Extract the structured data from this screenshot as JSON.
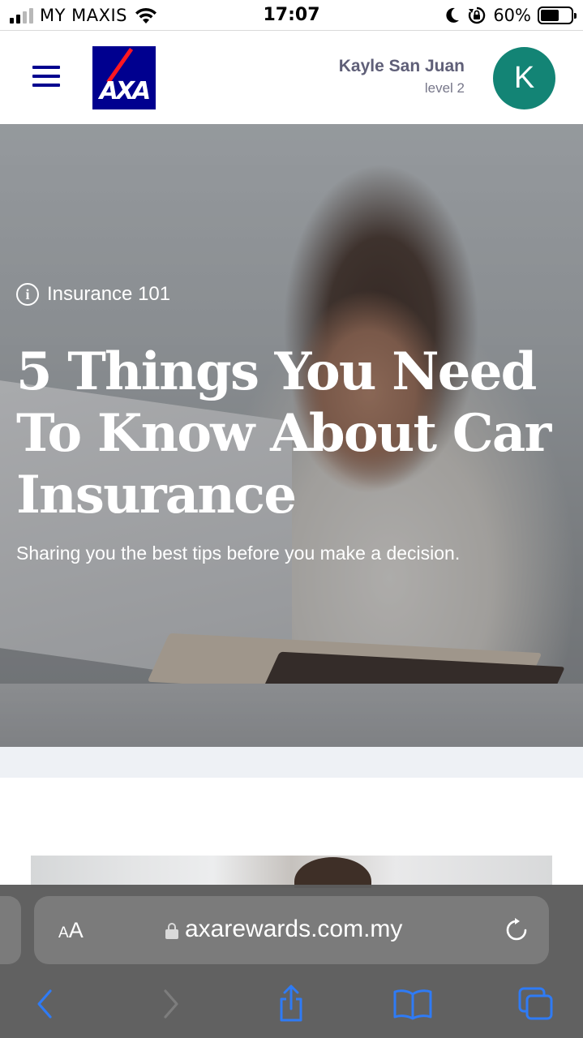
{
  "status_bar": {
    "carrier": "MY MAXIS",
    "time": "17:07",
    "battery_percent": "60%",
    "battery_level": 0.6
  },
  "header": {
    "logo_text": "AXA",
    "user_name": "Kayle San Juan",
    "user_level": "level 2",
    "avatar_initial": "K",
    "colors": {
      "brand": "#00008f",
      "avatar": "#138475",
      "logo_slash": "#ff1721"
    }
  },
  "hero": {
    "category": "Insurance 101",
    "title": "5 Things You Need To Know About Car Insurance",
    "subtitle": "Sharing you the best tips before you make a decision."
  },
  "browser": {
    "text_size_label_small": "A",
    "text_size_label_big": "A",
    "url": "axarewards.com.my",
    "icons": [
      "lock-icon",
      "reload-icon",
      "back-icon",
      "forward-icon",
      "share-icon",
      "bookmarks-icon",
      "tabs-icon"
    ]
  }
}
